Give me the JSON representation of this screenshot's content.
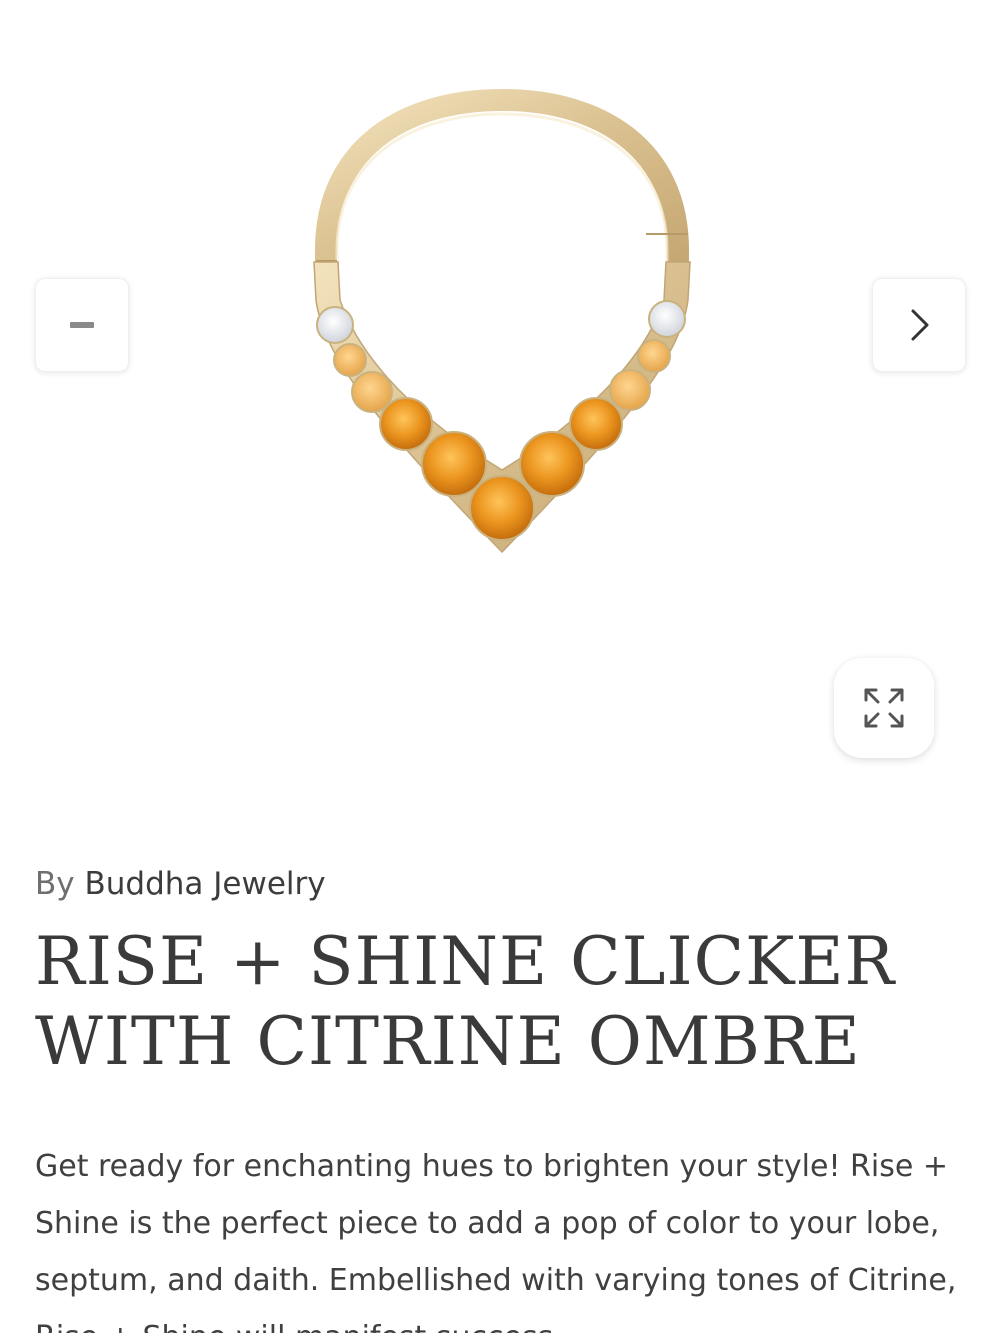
{
  "product": {
    "vendor_prefix": "By",
    "vendor_name": "Buddha Jewelry",
    "title": "RISE + SHINE CLICKER WITH CITRINE OMBRE",
    "description": "Get ready for enchanting hues to brighten your style! Rise + Shine is the perfect piece to add a pop of color to your lobe, septum, and daith. Embellished with varying tones of Citrine, Rise + Shine will manifest success."
  },
  "gallery": {
    "prev_icon": "minus-icon",
    "next_icon": "chevron-right-icon",
    "zoom_icon": "expand-icon",
    "image_subject": "gold clicker ring with citrine ombre stones"
  },
  "colors": {
    "gold": "#dcc393",
    "citrine": "#e8901a",
    "white_stone": "#f1f3f6",
    "text": "#3f3f3f"
  }
}
